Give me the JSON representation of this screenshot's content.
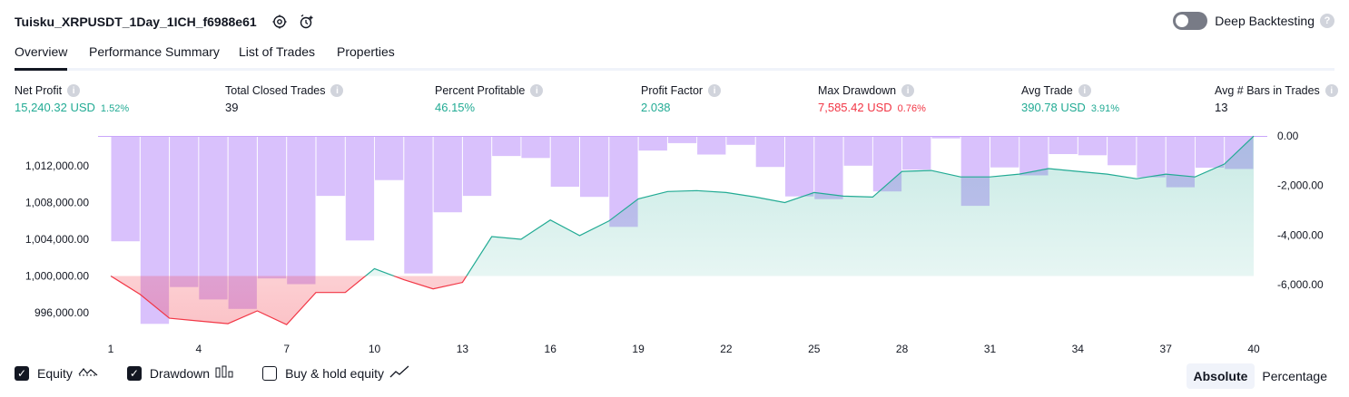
{
  "header": {
    "title": "Tuisku_XRPUSDT_1Day_1ICH_f6988e61",
    "deep_backtesting_label": "Deep Backtesting"
  },
  "tabs": [
    {
      "label": "Overview",
      "active": true
    },
    {
      "label": "Performance Summary",
      "active": false
    },
    {
      "label": "List of Trades",
      "active": false
    },
    {
      "label": "Properties",
      "active": false
    }
  ],
  "stats": [
    {
      "label": "Net Profit",
      "value": "15,240.32 USD",
      "pct": "1.52%",
      "color": "#22ab94"
    },
    {
      "label": "Total Closed Trades",
      "value": "39",
      "pct": "",
      "color": "#131722"
    },
    {
      "label": "Percent Profitable",
      "value": "46.15%",
      "pct": "",
      "color": "#22ab94"
    },
    {
      "label": "Profit Factor",
      "value": "2.038",
      "pct": "",
      "color": "#22ab94"
    },
    {
      "label": "Max Drawdown",
      "value": "7,585.42 USD",
      "pct": "0.76%",
      "color": "#f23645"
    },
    {
      "label": "Avg Trade",
      "value": "390.78 USD",
      "pct": "3.91%",
      "color": "#22ab94"
    },
    {
      "label": "Avg # Bars in Trades",
      "value": "13",
      "pct": "",
      "color": "#131722"
    }
  ],
  "chart_data": {
    "type": "area",
    "x_ticks": [
      "1",
      "4",
      "7",
      "10",
      "13",
      "16",
      "19",
      "22",
      "25",
      "28",
      "31",
      "34",
      "37",
      "40"
    ],
    "left_axis": {
      "ticks": [
        "1,012,000.00",
        "1,008,000.00",
        "1,004,000.00",
        "1,000,000.00",
        "996,000.00"
      ],
      "ylim": [
        994000,
        1015000
      ]
    },
    "right_axis": {
      "ticks": [
        "0.00",
        "-2,000.00",
        "-4,000.00",
        "-6,000.00"
      ],
      "ylim": [
        -7585.42,
        0
      ]
    },
    "equity_baseline": 1000000,
    "equity_x": [
      1,
      2,
      3,
      4,
      5,
      6,
      7,
      8,
      9,
      10,
      11,
      12,
      13,
      14,
      15,
      16,
      17,
      18,
      19,
      20,
      21,
      22,
      23,
      24,
      25,
      26,
      27,
      28,
      29,
      30,
      31,
      32,
      33,
      34,
      35,
      36,
      37,
      38,
      39,
      40
    ],
    "equity": [
      1000000,
      998000,
      995400,
      995100,
      994800,
      996200,
      994700,
      998200,
      998200,
      1000800,
      999600,
      998600,
      999300,
      1004300,
      1004000,
      1006100,
      1004400,
      1006000,
      1008400,
      1009200,
      1009300,
      1009100,
      1008600,
      1008000,
      1009100,
      1008700,
      1008600,
      1011400,
      1011500,
      1010800,
      1010800,
      1011100,
      1011700,
      1011400,
      1011100,
      1010600,
      1011100,
      1010800,
      1012200,
      1015240
    ],
    "drawdown": [
      0,
      -4250,
      -7585,
      -6100,
      -6600,
      -6980,
      -5750,
      -5980,
      -2420,
      -4220,
      -1780,
      -5550,
      -3080,
      -2420,
      -810,
      -890,
      -2050,
      -2460,
      -3670,
      -590,
      -290,
      -750,
      -360,
      -1250,
      -2440,
      -2550,
      -1200,
      -2240,
      -1360,
      -100,
      -2820,
      -1270,
      -1590,
      -730,
      -780,
      -1180,
      -1670,
      -2070,
      -1280,
      -1330,
      0
    ],
    "series": [
      {
        "name": "Equity",
        "color": "#22ab94",
        "negative_color": "#f23645"
      },
      {
        "name": "Drawdown",
        "color": "#c9a6fb"
      }
    ]
  },
  "legend": [
    {
      "label": "Equity",
      "checked": true,
      "icon": "equity-line-icon"
    },
    {
      "label": "Drawdown",
      "checked": true,
      "icon": "drawdown-bars-icon"
    },
    {
      "label": "Buy & hold equity",
      "checked": false,
      "icon": "buy-hold-line-icon"
    }
  ],
  "modes": [
    {
      "label": "Absolute",
      "active": true
    },
    {
      "label": "Percentage",
      "active": false
    }
  ]
}
